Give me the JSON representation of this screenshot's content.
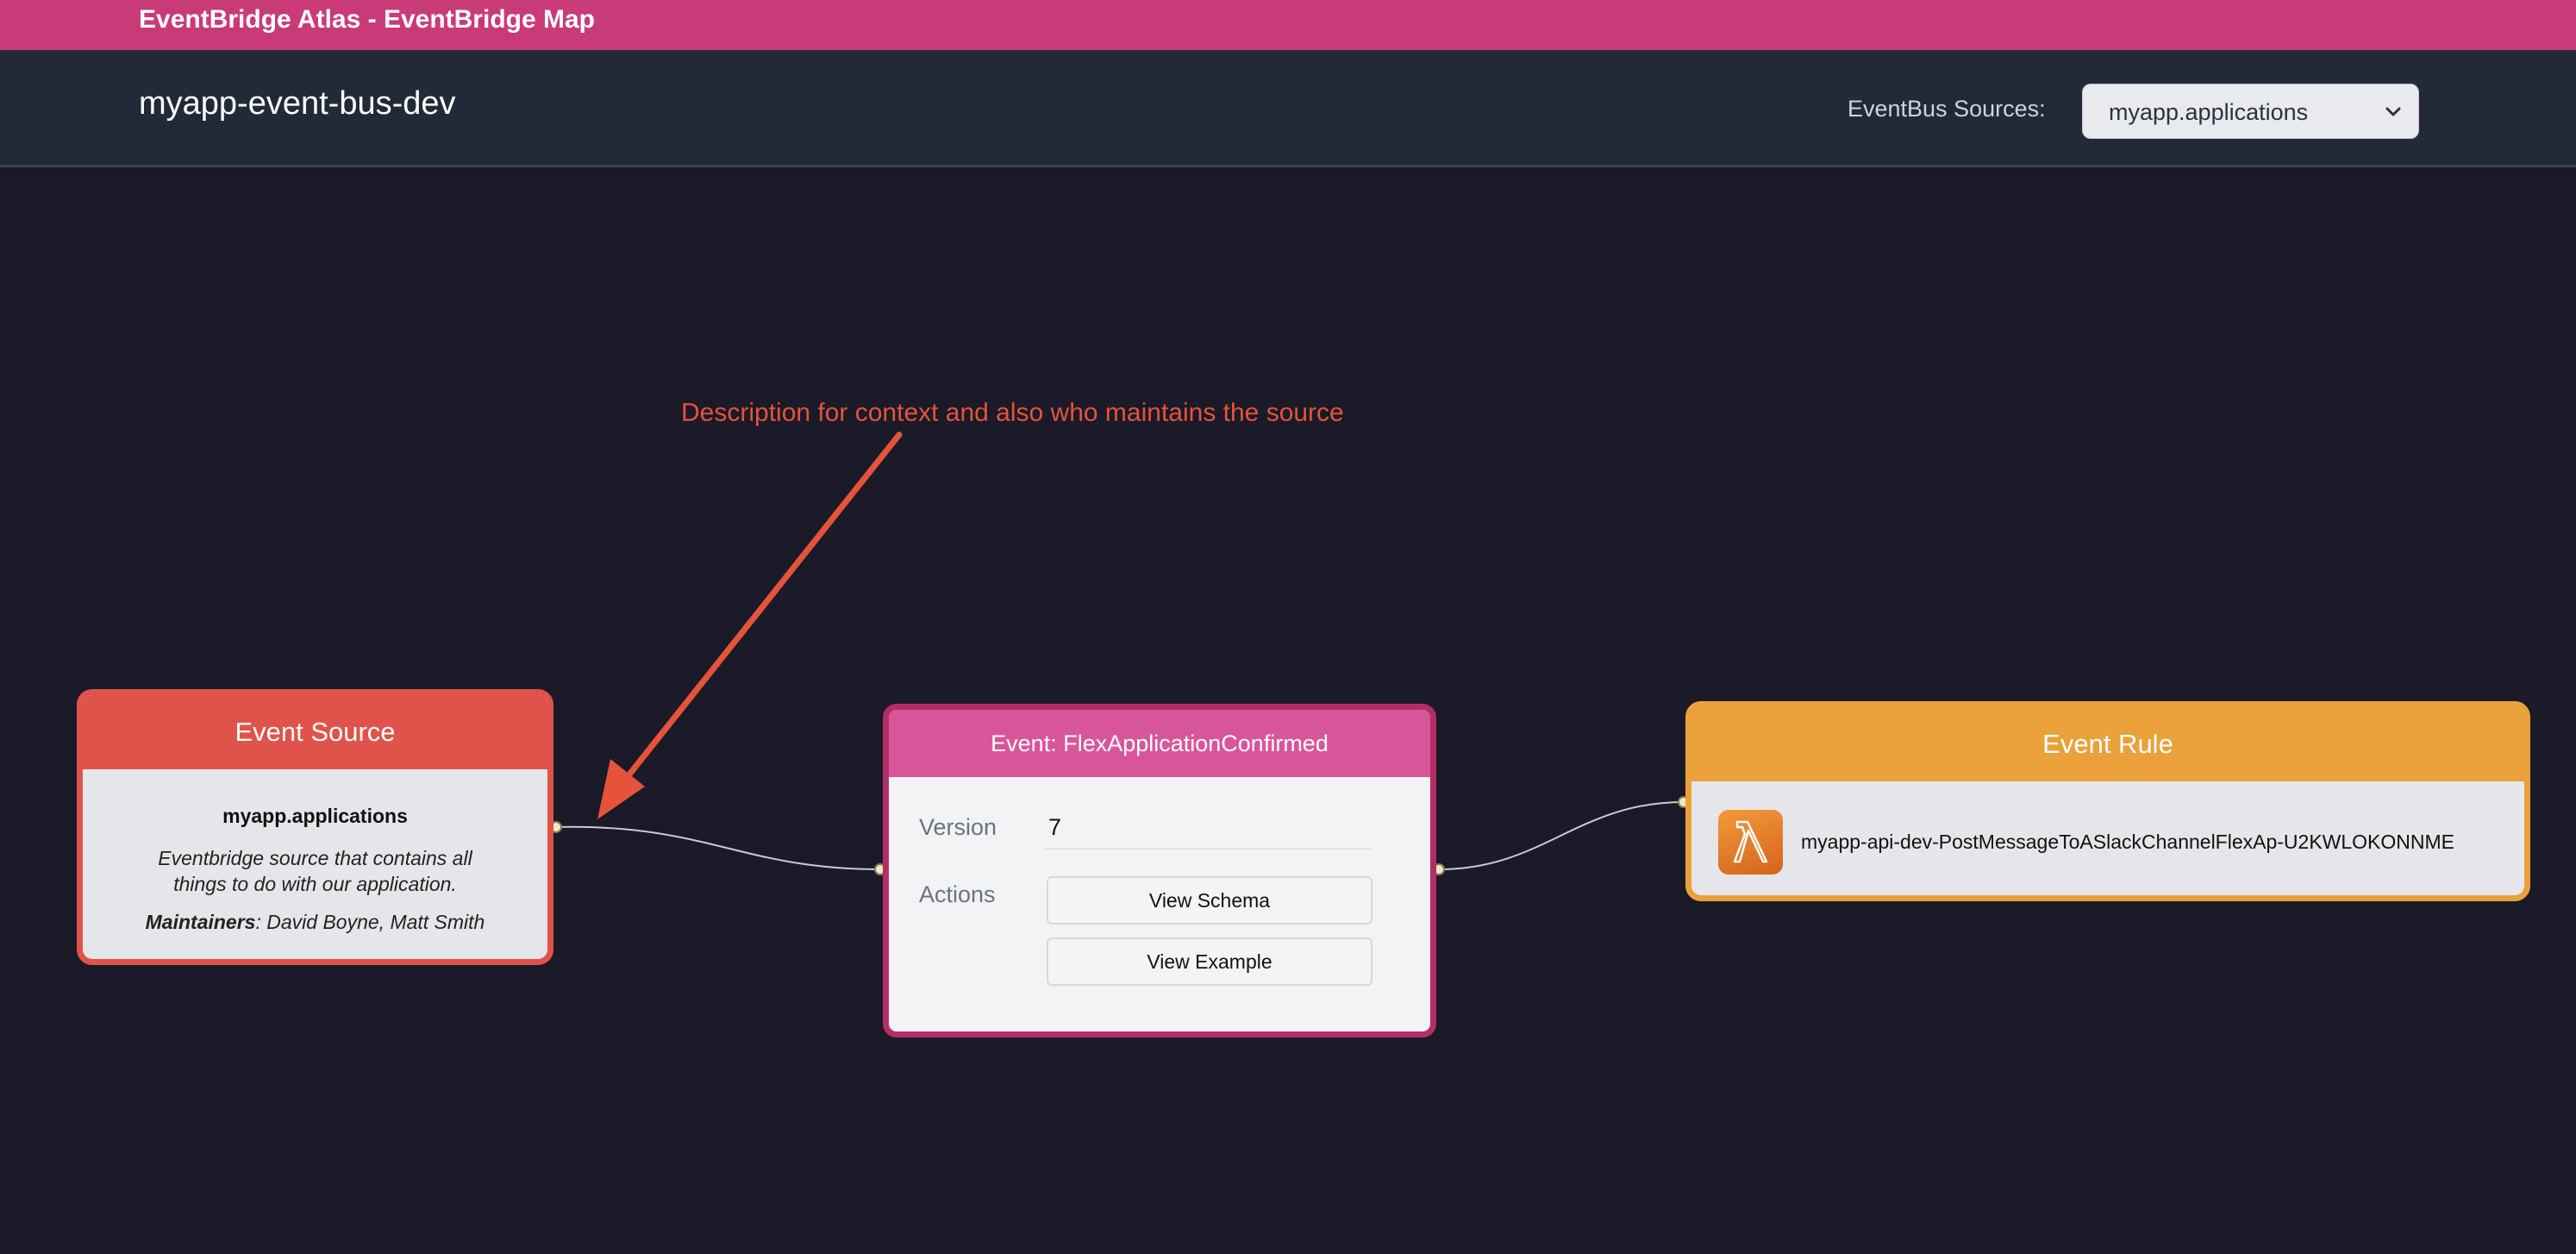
{
  "app": {
    "title": "EventBridge Atlas - EventBridge Map"
  },
  "header": {
    "bus_name": "myapp-event-bus-dev",
    "sources_label": "EventBus Sources:",
    "sources_selected": "myapp.applications"
  },
  "annotation": {
    "text": "Description for context and also who maintains the source",
    "color": "#e5533a"
  },
  "source_node": {
    "title": "Event Source",
    "name": "myapp.applications",
    "description": "Eventbridge source that contains all things to do with our application.",
    "maintainers_label": "Maintainers",
    "maintainers": ": David Boyne, Matt Smith",
    "color": "#e0534a"
  },
  "event_node": {
    "title": "Event: FlexApplicationConfirmed",
    "version_label": "Version",
    "version_value": "7",
    "actions_label": "Actions",
    "view_schema_label": "View Schema",
    "view_example_label": "View Example",
    "color": "#d9559a"
  },
  "rule_node": {
    "title": "Event Rule",
    "target_icon": "lambda-icon",
    "target_name": "myapp-api-dev-PostMessageToASlackChannelFlexAp-U2KWLOKONNME",
    "color": "#eaa13a"
  },
  "colors": {
    "topbar": "#c93a78",
    "header": "#222a38",
    "canvas": "#1a1a28"
  }
}
